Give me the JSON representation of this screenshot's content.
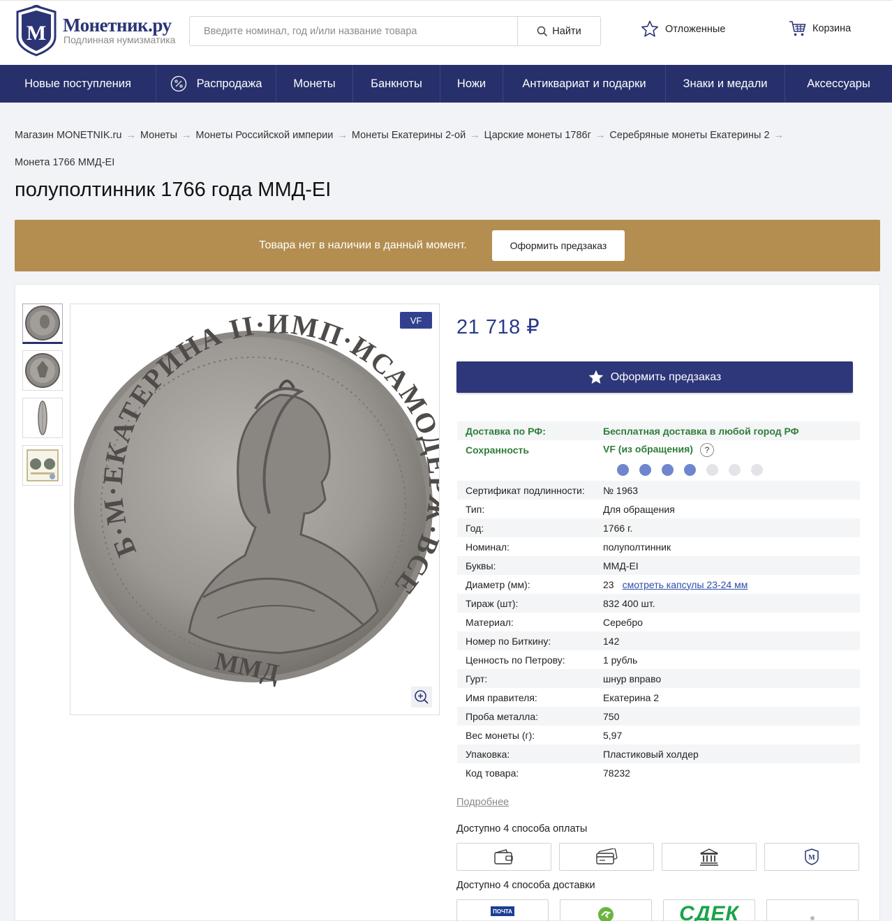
{
  "header": {
    "logo_name": "Монетник.ру",
    "logo_tagline": "Подлинная нумизматика",
    "search_placeholder": "Введите номинал, год и/или название товара",
    "search_button": "Найти",
    "saved_label": "Отложенные",
    "cart_label": "Корзина"
  },
  "nav": [
    "Новые поступления",
    "Распродажа",
    "Монеты",
    "Банкноты",
    "Ножи",
    "Антиквариат и подарки",
    "Знаки и медали",
    "Аксессуары"
  ],
  "breadcrumbs": [
    "Магазин MONETNIK.ru",
    "Монеты",
    "Монеты Российской империи",
    "Монеты Екатерины 2-ой",
    "Царские монеты 1786г",
    "Серебряные монеты Екатерины 2",
    "Монета 1766 ММД-EI"
  ],
  "product": {
    "title": "полуполтинник 1766 года ММД-EI",
    "notice_text": "Товара нет в наличии в данный момент.",
    "notice_button": "Оформить предзаказ",
    "grade_badge": "VF",
    "price": "21 718 ₽",
    "order_button": "Оформить предзаказ",
    "delivery_label": "Доставка по РФ:",
    "delivery_value": "Бесплатная доставка в любой город РФ",
    "condition_label": "Сохранность",
    "condition_value": "VF (из обращения)",
    "condition_help": "?",
    "condition_level": 4,
    "condition_scale": 7,
    "specs": [
      {
        "k": "Сертификат подлинности:",
        "v": "№ 1963"
      },
      {
        "k": "Тип:",
        "v": "Для обращения"
      },
      {
        "k": "Год:",
        "v": "1766 г."
      },
      {
        "k": "Номинал:",
        "v": "полуполтинник"
      },
      {
        "k": "Буквы:",
        "v": "ММД-EI"
      },
      {
        "k": "Диаметр (мм):",
        "v": "23",
        "link": "смотреть капсулы 23-24 мм"
      },
      {
        "k": "Тираж (шт):",
        "v": "832 400 шт."
      },
      {
        "k": "Материал:",
        "v": "Серебро"
      },
      {
        "k": "Номер по Биткину:",
        "v": "142"
      },
      {
        "k": "Ценность по Петрову:",
        "v": "1 рубль"
      },
      {
        "k": "Гурт:",
        "v": "шнур вправо"
      },
      {
        "k": "Имя правителя:",
        "v": "Екатерина 2"
      },
      {
        "k": "Проба металла:",
        "v": "750"
      },
      {
        "k": "Вес монеты (г):",
        "v": "5,97"
      },
      {
        "k": "Упаковка:",
        "v": "Пластиковый холдер"
      },
      {
        "k": "Код товара:",
        "v": "78232"
      }
    ],
    "more_link": "Подробнее",
    "payment_title": "Доступно 4 способа оплаты",
    "delivery_title": "Доступно 4 способа доставки",
    "delivery_logo_post": "ПОЧТА",
    "delivery_logo_cdek": "СДЕК",
    "coin_legend": "Б·М·ЕКАТЕРИНА II·ИМП·ИСАМОДЕРЖ·ВСЕРОС",
    "coin_mint": "ММД"
  },
  "colors": {
    "brand_navy": "#27306a",
    "notice_gold": "#b38e50",
    "price_blue": "#2b3a8a",
    "green": "#2f7d3a"
  }
}
